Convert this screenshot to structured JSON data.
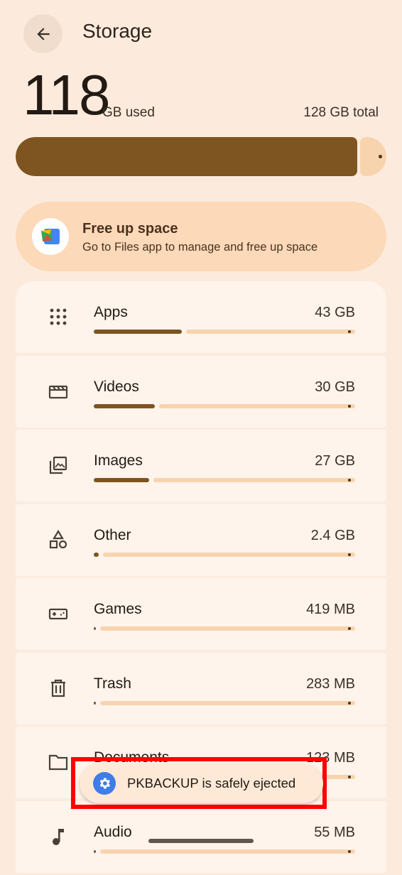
{
  "header": {
    "title": "Storage",
    "back_icon": "arrow-back-icon"
  },
  "summary": {
    "used_value": "118",
    "used_unit": "GB used",
    "total": "128 GB total",
    "used_fraction": 0.922
  },
  "free_up": {
    "icon": "files-app-icon",
    "title": "Free up space",
    "subtitle": "Go to Files app to manage and free up space"
  },
  "categories": [
    {
      "name": "Apps",
      "size": "43 GB",
      "fraction": 0.336,
      "icon": "apps-grid-icon"
    },
    {
      "name": "Videos",
      "size": "30 GB",
      "fraction": 0.234,
      "icon": "video-clapper-icon"
    },
    {
      "name": "Images",
      "size": "27 GB",
      "fraction": 0.211,
      "icon": "image-gallery-icon"
    },
    {
      "name": "Other",
      "size": "2.4 GB",
      "fraction": 0.019,
      "icon": "shapes-icon"
    },
    {
      "name": "Games",
      "size": "419 MB",
      "fraction": 0.003,
      "icon": "gamepad-icon"
    },
    {
      "name": "Trash",
      "size": "283 MB",
      "fraction": 0.002,
      "icon": "trash-icon"
    },
    {
      "name": "Documents",
      "size": "123 MB",
      "fraction": 0.001,
      "icon": "folder-icon"
    },
    {
      "name": "Audio",
      "size": "55 MB",
      "fraction": 0.0004,
      "icon": "music-note-icon"
    }
  ],
  "toast": {
    "text": "PKBACKUP is safely ejected",
    "icon": "settings-gear-icon"
  },
  "colors": {
    "background": "#fcebdd",
    "accent_fill": "#7e5420",
    "track": "#f7d4ae",
    "card": "#fef4ec",
    "free_card": "#fcd9b8",
    "toast_icon": "#3f7de8",
    "highlight": "#ff0000"
  }
}
